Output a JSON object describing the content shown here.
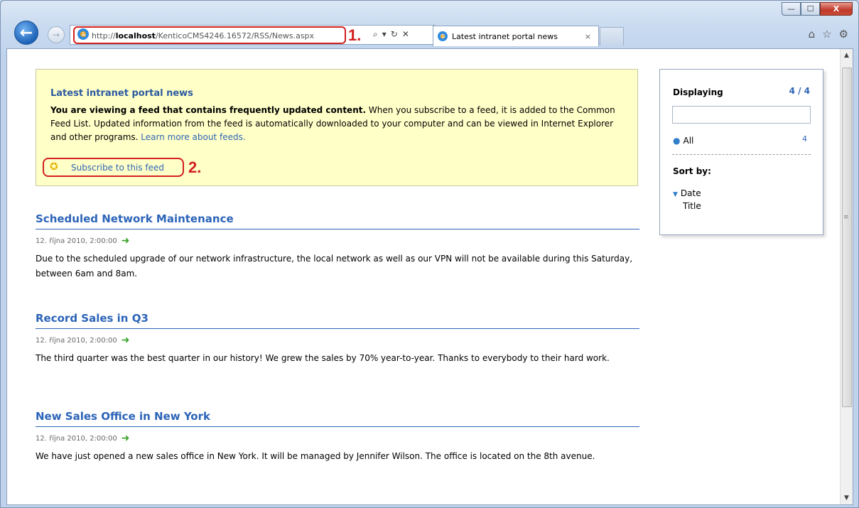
{
  "window": {
    "caption_buttons": {
      "minimize": "—",
      "maximize": "☐",
      "close": "X"
    }
  },
  "nav": {
    "back_icon": "back-arrow-icon",
    "forward_icon": "forward-arrow-icon",
    "url_prefix": "http://",
    "url_host": "localhost",
    "url_path": "/KenticoCMS4246.16572/RSS/News.aspx",
    "annotation_1": "1.",
    "tools": [
      "search-icon",
      "dropdown-icon",
      "refresh-icon",
      "stop-icon"
    ]
  },
  "tab": {
    "title": "Latest intranet portal news",
    "close": "×"
  },
  "toolbar_right": [
    "home-icon",
    "favorites-star-icon",
    "gear-icon"
  ],
  "info": {
    "title": "Latest intranet portal news",
    "bold_text": "You are viewing a feed that contains frequently updated content.",
    "text": " When you subscribe to a feed, it is added to the Common Feed List. Updated information from the feed is automatically downloaded to your computer and can be viewed in Internet Explorer and other programs. ",
    "learn_more": "Learn more about feeds.",
    "subscribe": "Subscribe to this feed",
    "annotation_2": "2."
  },
  "articles": [
    {
      "title": "Scheduled Network Maintenance",
      "date": "12. října 2010, 2:00:00",
      "body": "Due to the scheduled upgrade of our network infrastructure, the local network as well as our VPN will not be available during this Saturday, between 6am and 8am."
    },
    {
      "title": "Record Sales in Q3",
      "date": "12. října 2010, 2:00:00",
      "body": "The third quarter was the best quarter in our history! We grew the sales by 70% year-to-year. Thanks to everybody to their hard work."
    },
    {
      "title": "New Sales Office in New York",
      "date": "12. října 2010, 2:00:00",
      "body": "We have just opened a new sales office in New York. It will be managed by Jennifer Wilson. The office is located on the 8th avenue."
    }
  ],
  "side_panel": {
    "displaying_label": "Displaying",
    "displaying_count": "4 / 4",
    "filter_all": "All",
    "filter_all_count": "4",
    "sort_label": "Sort by:",
    "sort_date": "Date",
    "sort_title": "Title"
  }
}
